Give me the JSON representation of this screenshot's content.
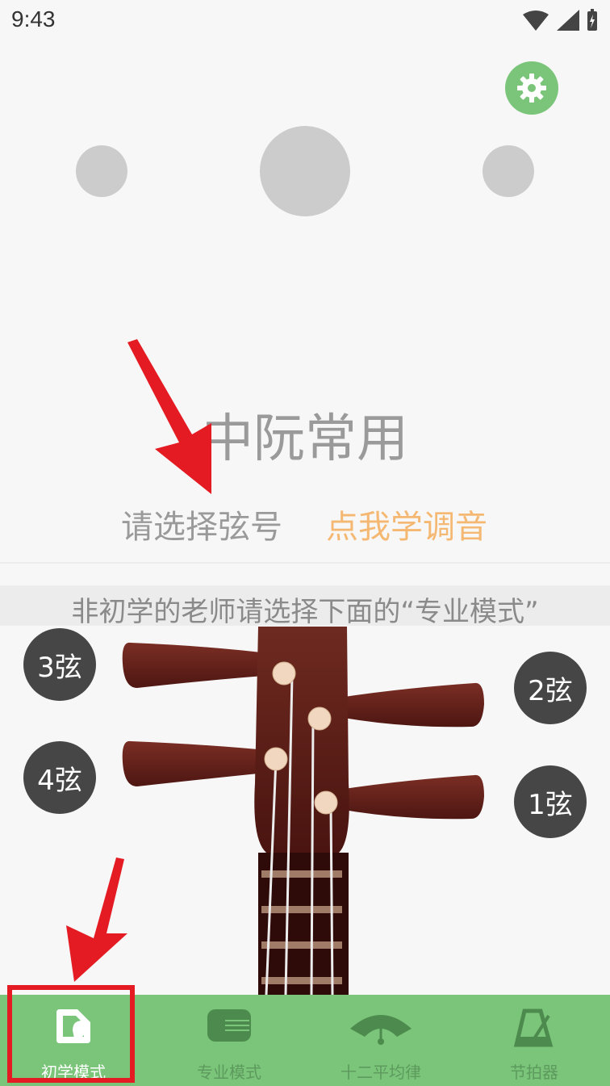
{
  "status_bar": {
    "time": "9:43"
  },
  "tuner": {
    "instrument_name": "中阮常用",
    "select_prompt": "请选择弦号",
    "learn_link": "点我学调音"
  },
  "notice": {
    "text": "非初学的老师请选择下面的“专业模式”"
  },
  "strings": [
    {
      "label": "3弦"
    },
    {
      "label": "2弦"
    },
    {
      "label": "4弦"
    },
    {
      "label": "1弦"
    }
  ],
  "tabs": [
    {
      "label": "初学模式",
      "icon": "beginner-mode-icon",
      "active": true
    },
    {
      "label": "专业模式",
      "icon": "professional-mode-icon",
      "active": false
    },
    {
      "label": "十二平均律",
      "icon": "twelve-tone-icon",
      "active": false
    },
    {
      "label": "节拍器",
      "icon": "metronome-icon",
      "active": false
    }
  ],
  "colors": {
    "accent_green": "#7ac57a",
    "link_orange": "#f5b872",
    "annotation_red": "#e41b23"
  }
}
